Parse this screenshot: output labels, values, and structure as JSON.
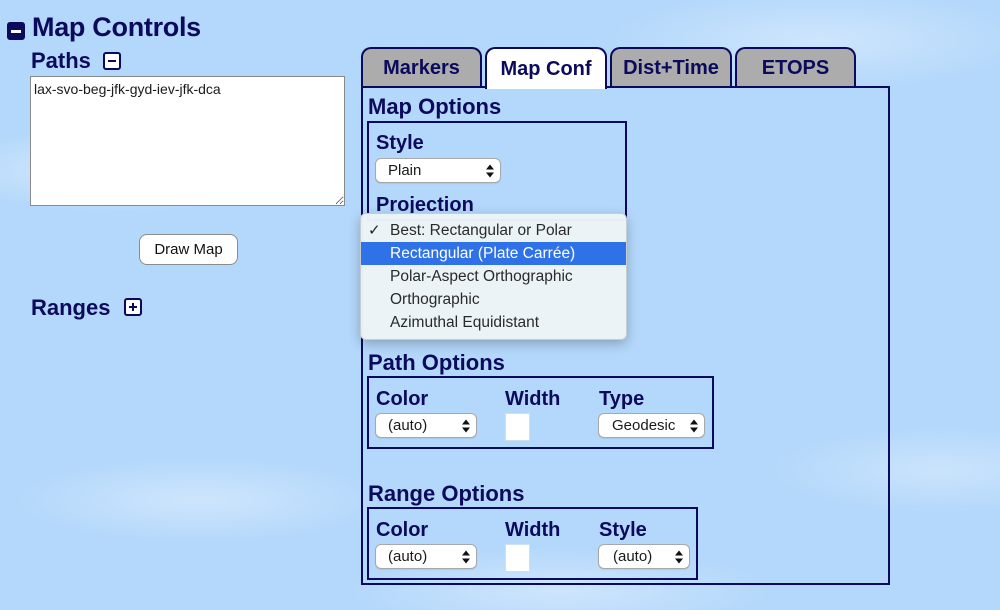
{
  "header": {
    "title": "Map Controls",
    "collapse_icon": "minus-box-icon"
  },
  "paths": {
    "label": "Paths",
    "toggle_icon": "minus-box-icon",
    "value": "lax-svo-beg-jfk-gyd-iev-jfk-dca",
    "draw_button": "Draw Map"
  },
  "ranges": {
    "label": "Ranges",
    "toggle_icon": "plus-box-icon"
  },
  "tabs": [
    {
      "label": "Markers",
      "active": false
    },
    {
      "label": "Map Conf",
      "active": true
    },
    {
      "label": "Dist+Time",
      "active": false
    },
    {
      "label": "ETOPS",
      "active": false
    }
  ],
  "map_options": {
    "title": "Map Options",
    "style_label": "Style",
    "style_value": "Plain",
    "projection_label": "Projection",
    "projection_menu": {
      "items": [
        {
          "label": "Best: Rectangular or Polar",
          "checked": true,
          "highlighted": false
        },
        {
          "label": "Rectangular (Plate Carrée)",
          "checked": false,
          "highlighted": true
        },
        {
          "label": "Polar-Aspect Orthographic",
          "checked": false,
          "highlighted": false
        },
        {
          "label": "Orthographic",
          "checked": false,
          "highlighted": false
        },
        {
          "label": "Azimuthal Equidistant",
          "checked": false,
          "highlighted": false
        }
      ],
      "check_glyph": "✓"
    }
  },
  "path_options": {
    "title": "Path Options",
    "color_label": "Color",
    "color_value": "(auto)",
    "width_label": "Width",
    "width_value": "",
    "type_label": "Type",
    "type_value": "Geodesic"
  },
  "range_options": {
    "title": "Range Options",
    "color_label": "Color",
    "color_value": "(auto)",
    "width_label": "Width",
    "width_value": "",
    "style_label": "Style",
    "style_value": "(auto)"
  },
  "colors": {
    "navy": "#0c0a5c",
    "background": "#b4d8fb",
    "tab_inactive": "#acacac",
    "menu_highlight": "#2f72e8"
  }
}
